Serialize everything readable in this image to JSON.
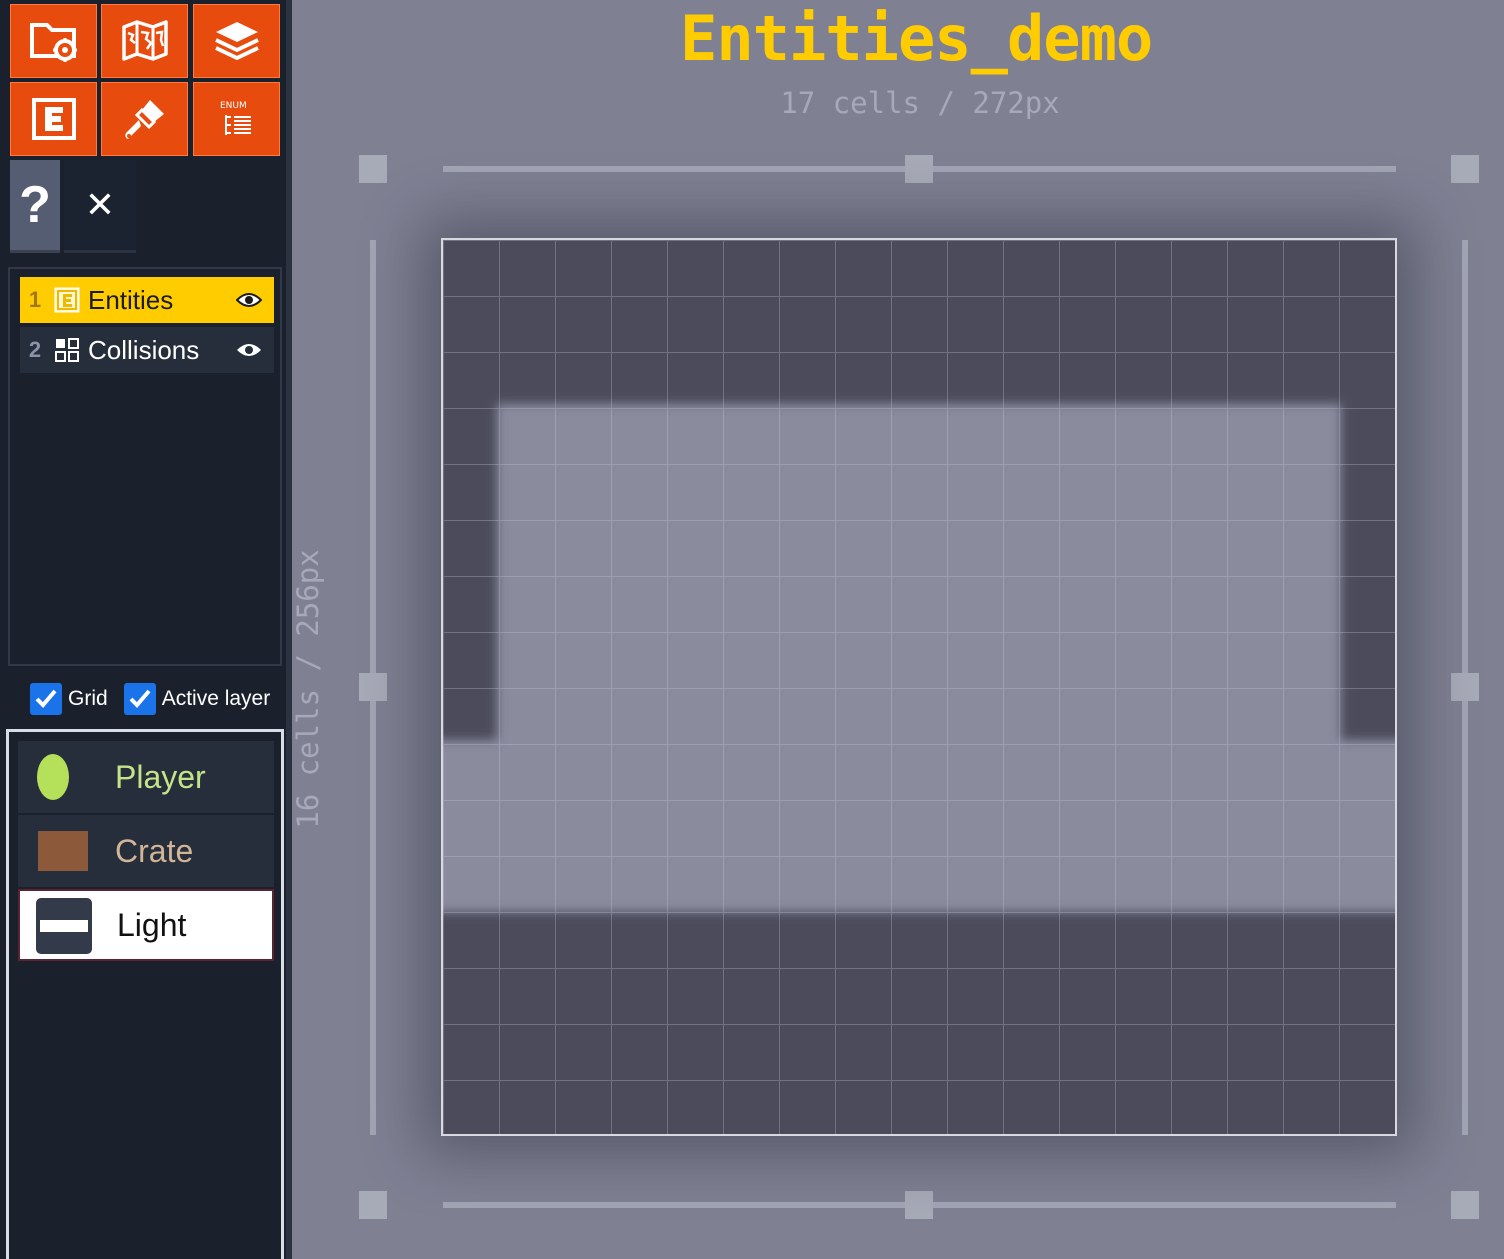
{
  "toolbar": {
    "buttons": [
      {
        "name": "project-settings-button",
        "icon": "folder-gear-icon"
      },
      {
        "name": "world-map-button",
        "icon": "map-icon"
      },
      {
        "name": "layers-button",
        "icon": "layers-icon"
      },
      {
        "name": "entities-button",
        "icon": "entity-e-icon"
      },
      {
        "name": "tilesets-button",
        "icon": "brush-icon"
      },
      {
        "name": "enums-button",
        "icon": "enum-list-icon",
        "label": "ENUM"
      }
    ],
    "help_label": "?",
    "close_label": "✕"
  },
  "layers": [
    {
      "index": "1",
      "name": "Entities",
      "type_icon": "entity-e-icon",
      "selected": true,
      "visible": true
    },
    {
      "index": "2",
      "name": "Collisions",
      "type_icon": "grid-icon",
      "selected": false,
      "visible": true
    }
  ],
  "options": {
    "grid_label": "Grid",
    "grid_checked": true,
    "active_layer_label": "Active layer",
    "active_layer_checked": true
  },
  "entities": [
    {
      "name": "Player",
      "icon": "ellipse-icon",
      "color": "#b5e05a",
      "selected": false
    },
    {
      "name": "Crate",
      "icon": "square-icon",
      "color": "#8c5a3a",
      "selected": false
    },
    {
      "name": "Light",
      "icon": "light-bar-icon",
      "color": "#333a4a",
      "selected": true
    }
  ],
  "level": {
    "title": "Entities_demo",
    "width_label": "17 cells / 272px",
    "height_label": "16 cells / 256px"
  },
  "colors": {
    "accent": "#ffcc00",
    "toolbar": "#e74c0e",
    "panel_bg": "#1a212d",
    "canvas_bg": "#7f8193",
    "wall": "#4b4c5b",
    "floor": "#8a8c9e"
  }
}
